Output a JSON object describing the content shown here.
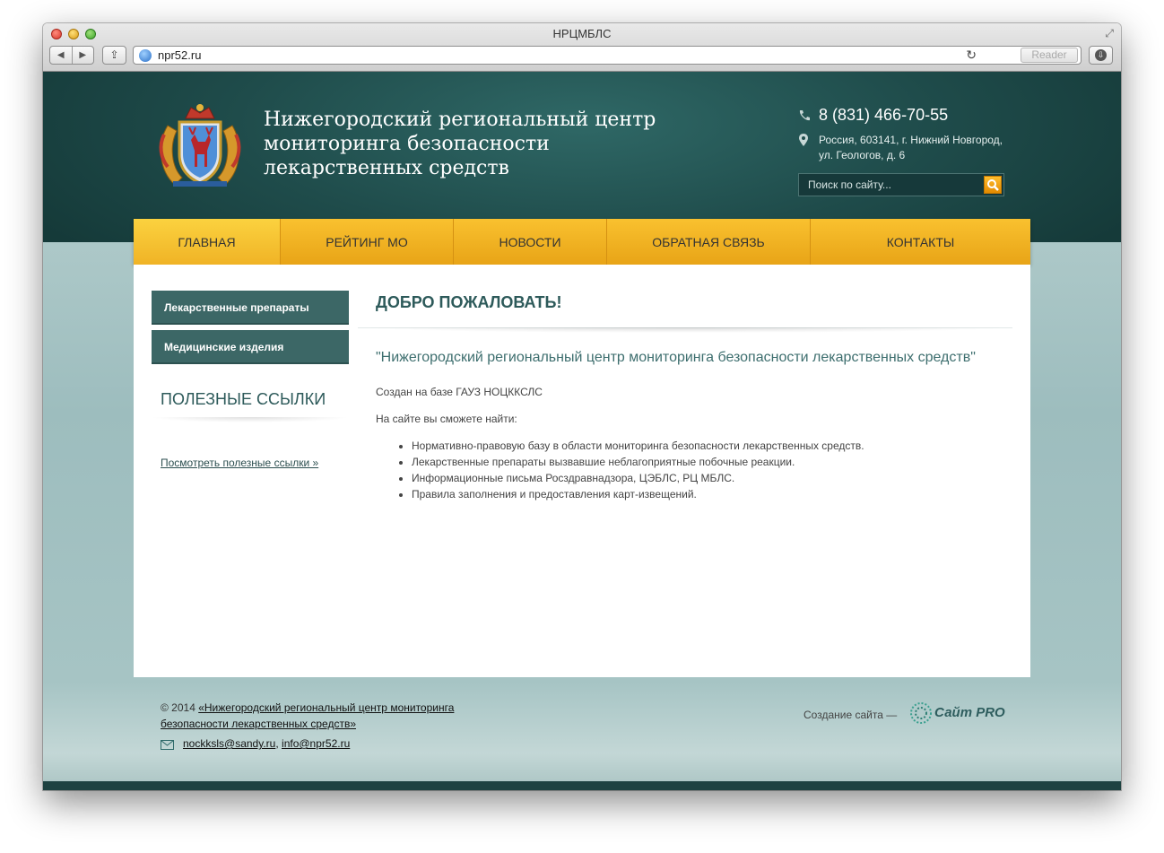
{
  "browser": {
    "window_title": "НРЦМБЛС",
    "url": "npr52.ru",
    "reader_label": "Reader",
    "back_glyph": "◀",
    "forward_glyph": "▶",
    "share_glyph": "⇪",
    "reload_glyph": "↻",
    "resize_glyph": "⤢",
    "download_glyph": "⇩"
  },
  "header": {
    "site_title": "Нижегородский региональный центр мониторинга безопасности лекарственных средств",
    "phone": "8 (831) 466-70-55",
    "address_line1": "Россия, 603141, г. Нижний Новгород,",
    "address_line2": "ул. Геологов, д. 6",
    "search_placeholder": "Поиск по сайту..."
  },
  "nav": {
    "items": [
      {
        "label": "ГЛАВНАЯ"
      },
      {
        "label": "РЕЙТИНГ МО"
      },
      {
        "label": "НОВОСТИ"
      },
      {
        "label": "ОБРАТНАЯ СВЯЗЬ"
      },
      {
        "label": "КОНТАКТЫ"
      }
    ]
  },
  "sidebar": {
    "links": [
      {
        "label": "Лекарственные препараты"
      },
      {
        "label": "Медицинские изделия"
      }
    ],
    "useful_title": "ПОЛЕЗНЫЕ ССЫЛКИ",
    "useful_more": "Посмотреть полезные ссылки »"
  },
  "main": {
    "title": "ДОБРО ПОЖАЛОВАТЬ!",
    "quote": "\"Нижегородский региональный центр мониторинга безопасности лекарственных средств\"",
    "para1": "Создан на базе ГАУЗ НОЦККСЛС",
    "para2": "На сайте вы сможете найти:",
    "bullets": [
      "Нормативно-правовую базу в области мониторинга безопасности лекарственных средств.",
      "Лекарственные препараты вызвавшие неблагоприятные побочные реакции.",
      "Информационные письма Росздравнадзора, ЦЭБЛС, РЦ МБЛС.",
      "Правила заполнения и предоставления карт-извещений."
    ]
  },
  "footer": {
    "copyright_prefix": "© 2014",
    "copyright_link": "«Нижегородский региональный центр мониторинга безопасности лекарственных средств»",
    "email1": "nockksls@sandy.ru",
    "email_sep": ",",
    "email2": "info@npr52.ru",
    "credit_text": "Создание сайта —",
    "credit_logo": "Сайт PRO"
  },
  "colors": {
    "header_bg": "#1f4c4b",
    "nav_accent": "#f0b326",
    "sidebar_link_bg": "#3c6766",
    "heading_color": "#2d5a5a"
  },
  "icons": {
    "phone": "phone-icon",
    "address": "map-pin-icon",
    "search": "search-icon",
    "mail": "mail-icon",
    "emblem": "coat-of-arms-emblem"
  }
}
